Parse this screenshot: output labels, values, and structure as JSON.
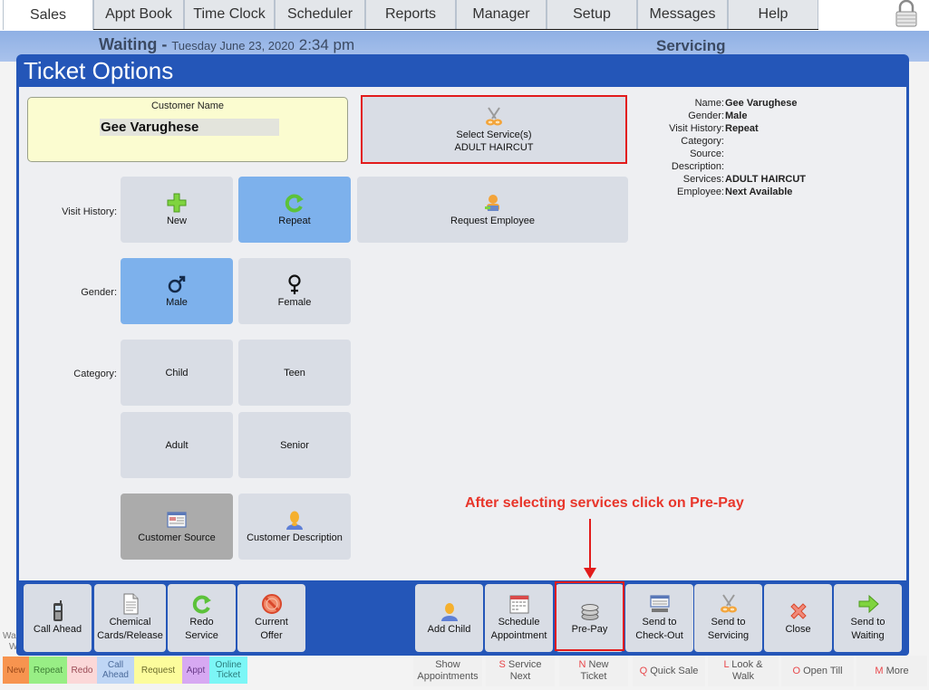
{
  "top_tabs": [
    {
      "label": "Sales",
      "active": true
    },
    {
      "label": "Appt Book"
    },
    {
      "label": "Time Clock"
    },
    {
      "label": "Scheduler"
    },
    {
      "label": "Reports"
    },
    {
      "label": "Manager"
    },
    {
      "label": "Setup"
    },
    {
      "label": "Messages"
    },
    {
      "label": "Help"
    }
  ],
  "status_bar": {
    "waiting_label": "Waiting - ",
    "date": "Tuesday June 23, 2020",
    "time": "2:34 pm",
    "servicing_label": "Servicing"
  },
  "dialog": {
    "title": "Ticket Options",
    "customer_name_label": "Customer Name",
    "customer_name_value": "Gee Varughese",
    "select_services": {
      "label": "Select Service(s)",
      "value": "ADULT HAIRCUT"
    },
    "request_employee": "Request Employee",
    "visit_history": {
      "label": "Visit History:",
      "options": [
        "New",
        "Repeat"
      ],
      "selected": "Repeat"
    },
    "gender": {
      "label": "Gender:",
      "options": [
        "Male",
        "Female"
      ],
      "selected": "Male"
    },
    "category": {
      "label": "Category:",
      "options": [
        "Child",
        "Teen",
        "Adult",
        "Senior"
      ],
      "selected": ""
    },
    "customer_source": "Customer Source",
    "customer_description": "Customer Description",
    "summary": [
      {
        "key": "Name:",
        "value": "Gee Varughese"
      },
      {
        "key": "Gender:",
        "value": "Male"
      },
      {
        "key": "Visit History:",
        "value": "Repeat"
      },
      {
        "key": "Category:",
        "value": ""
      },
      {
        "key": "Source:",
        "value": ""
      },
      {
        "key": "Description:",
        "value": ""
      },
      {
        "key": "Services:",
        "value": "ADULT HAIRCUT"
      },
      {
        "key": "Employee:",
        "value": "Next Available"
      }
    ],
    "annotation": "After selecting services click on Pre-Pay"
  },
  "actions_left": [
    {
      "label1": "Call Ahead",
      "label2": ""
    },
    {
      "label1": "Chemical",
      "label2": "Cards/Release"
    },
    {
      "label1": "Redo",
      "label2": "Service"
    },
    {
      "label1": "Current",
      "label2": "Offer"
    }
  ],
  "actions_right": [
    {
      "label1": "Add Child",
      "label2": ""
    },
    {
      "label1": "Schedule",
      "label2": "Appointment"
    },
    {
      "label1": "Pre-Pay",
      "label2": ""
    },
    {
      "label1": "Send to",
      "label2": "Check-Out"
    },
    {
      "label1": "Send to",
      "label2": "Servicing"
    },
    {
      "label1": "Close",
      "label2": ""
    },
    {
      "label1": "Send to",
      "label2": "Waiting"
    }
  ],
  "legend": [
    {
      "label1": "New",
      "label2": "",
      "color": "#f7944f",
      "text": "#9b4a1a"
    },
    {
      "label1": "Repeat",
      "label2": "",
      "color": "#98ee85",
      "text": "#3e7f36"
    },
    {
      "label1": "Redo",
      "label2": "",
      "color": "#fbd8d8",
      "text": "#9a4b55"
    },
    {
      "label1": "Call",
      "label2": "Ahead",
      "color": "#bfd6f5",
      "text": "#4a6a9a"
    },
    {
      "label1": "Request",
      "label2": "",
      "color": "#fcfc9c",
      "text": "#6c6c2c"
    },
    {
      "label1": "Appt",
      "label2": "",
      "color": "#d7a9f2",
      "text": "#6a3a8a"
    },
    {
      "label1": "Online",
      "label2": "Ticket",
      "color": "#7cf6f6",
      "text": "#2a7a7a"
    }
  ],
  "background_buttons": [
    {
      "hot": "",
      "label1": "Show",
      "label2": "Appointments"
    },
    {
      "hot": "S",
      "label1": " Service",
      "label2": "Next"
    },
    {
      "hot": "N",
      "label1": " New",
      "label2": "Ticket"
    },
    {
      "hot": "Q",
      "label1": " Quick Sale",
      "label2": ""
    },
    {
      "hot": "L",
      "label1": " Look &",
      "label2": "Walk"
    },
    {
      "hot": "O",
      "label1": " Open Till",
      "label2": ""
    },
    {
      "hot": "M",
      "label1": " More",
      "label2": ""
    }
  ],
  "waiting_peek": {
    "line1": "Wa",
    "line2": "W"
  },
  "colors": {
    "dialog_blue": "#2456b8",
    "selected_blue": "#7db1ec",
    "button_gray": "#d9dde5",
    "highlight_red": "#e21b1b",
    "customer_box_yellow": "#fbfcd0"
  }
}
